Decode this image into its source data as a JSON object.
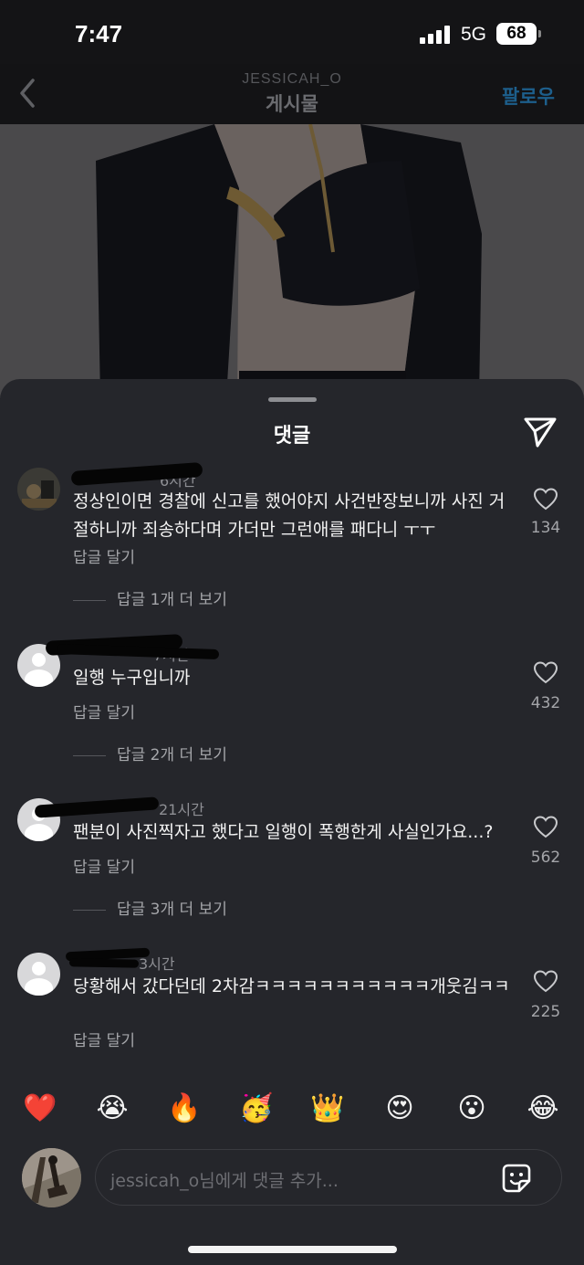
{
  "status_bar": {
    "time": "7:47",
    "network": "5G",
    "battery": "68"
  },
  "header": {
    "username": "JESSICAH_O",
    "title": "게시물",
    "follow_label": "팔로우"
  },
  "sheet": {
    "title": "댓글"
  },
  "comments": [
    {
      "time": "6시간",
      "text": "정상인이면 경찰에 신고를 했어야지 사건반장보니까 사진 거절하니까 죄송하다며 가더만 그런애를 패다니 ㅜㅜ",
      "reply": "답글 달기",
      "more": "답글 1개 더 보기",
      "likes": "134"
    },
    {
      "time": "7시간",
      "text": "일행 누구입니까",
      "reply": "답글 달기",
      "more": "답글 2개 더 보기",
      "likes": "432"
    },
    {
      "time": "21시간",
      "text": "팬분이 사진찍자고 했다고 일행이 폭행한게 사실인가요...?",
      "reply": "답글 달기",
      "more": "답글 3개 더 보기",
      "likes": "562"
    },
    {
      "time": "3시간",
      "text": "당황해서 갔다던데 2차감ㅋㅋㅋㅋㅋㅋㅋㅋㅋㅋㅋ개웃김ㅋㅋ",
      "reply": "답글 달기",
      "likes": "225"
    }
  ],
  "emoji_bar": [
    "❤️",
    "😭",
    "🔥",
    "🥳",
    "👑",
    "😍",
    "😮",
    "😂"
  ],
  "input": {
    "placeholder": "jessicah_o님에게 댓글 추가..."
  }
}
